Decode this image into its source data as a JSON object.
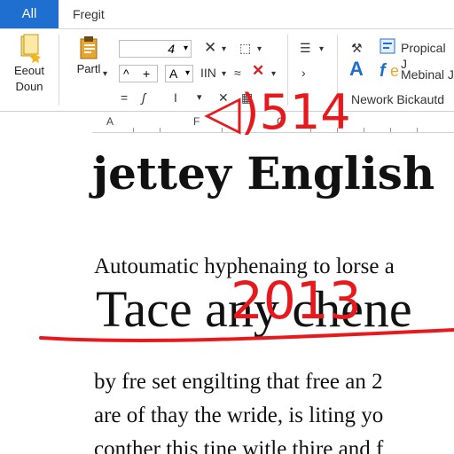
{
  "tabs": {
    "active": "All",
    "second": "Fregit"
  },
  "ribbon": {
    "left_button": {
      "label_1": "Eeout",
      "label_2": "Doun"
    },
    "paste": {
      "label": "Partl"
    },
    "font_size": "4",
    "grow": "A",
    "lines": "IIN",
    "styles": {
      "item1": "Propical J",
      "item2": "Mebinal J",
      "item3": "Nework Bickautd"
    }
  },
  "ruler": {
    "marks": [
      "A",
      "F",
      "C"
    ]
  },
  "document": {
    "heading": "jettey English",
    "line1": "Autoumatic hyphenaing to lorse a",
    "big_line": "Tace any chene",
    "para1": "by fre set engilting that free an 2",
    "para2": "are of thay the wride, is liting yo",
    "para3": "conther this tine witle thire and f"
  },
  "annotations": {
    "top": "◁)514",
    "middle": "2013"
  },
  "colors": {
    "accent": "#1f6fd1",
    "ink": "#e8191d"
  }
}
